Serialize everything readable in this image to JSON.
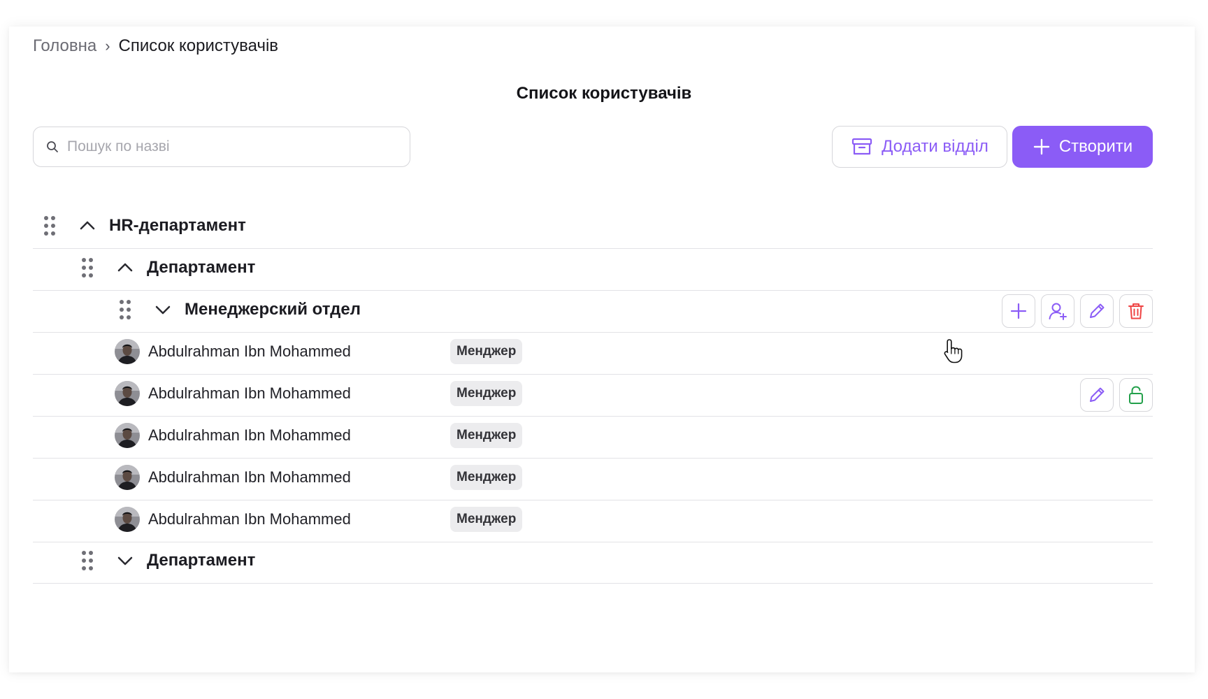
{
  "breadcrumb": {
    "home": "Головна",
    "separator": "›",
    "current": "Список користувачів"
  },
  "page_title": "Список користувачів",
  "search": {
    "placeholder": "Пошук по назві",
    "value": ""
  },
  "toolbar": {
    "add_department_label": "Додати відділ",
    "create_label": "Створити"
  },
  "colors": {
    "accent": "#8b5cf6",
    "delete": "#ef4444",
    "unlock": "#22a04a",
    "border": "#d6d6da",
    "badge_bg": "#ececee"
  },
  "tree": {
    "root": {
      "name": "HR-департамент",
      "expanded": true
    },
    "department_1": {
      "name": "Департамент",
      "expanded": true
    },
    "subdepartment": {
      "name": "Менеджерский отдел",
      "expanded": false,
      "actions": [
        "plus-icon",
        "user-plus-icon",
        "pencil-icon",
        "trash-icon"
      ]
    },
    "users": [
      {
        "name": "Abdulrahman Ibn Mohammed",
        "role": "Менджер"
      },
      {
        "name": "Abdulrahman Ibn Mohammed",
        "role": "Менджер",
        "actions": [
          "pencil-icon",
          "unlock-icon"
        ]
      },
      {
        "name": "Abdulrahman Ibn Mohammed",
        "role": "Менджер"
      },
      {
        "name": "Abdulrahman Ibn Mohammed",
        "role": "Менджер"
      },
      {
        "name": "Abdulrahman Ibn Mohammed",
        "role": "Менджер"
      }
    ],
    "department_2": {
      "name": "Департамент",
      "expanded": false
    }
  }
}
